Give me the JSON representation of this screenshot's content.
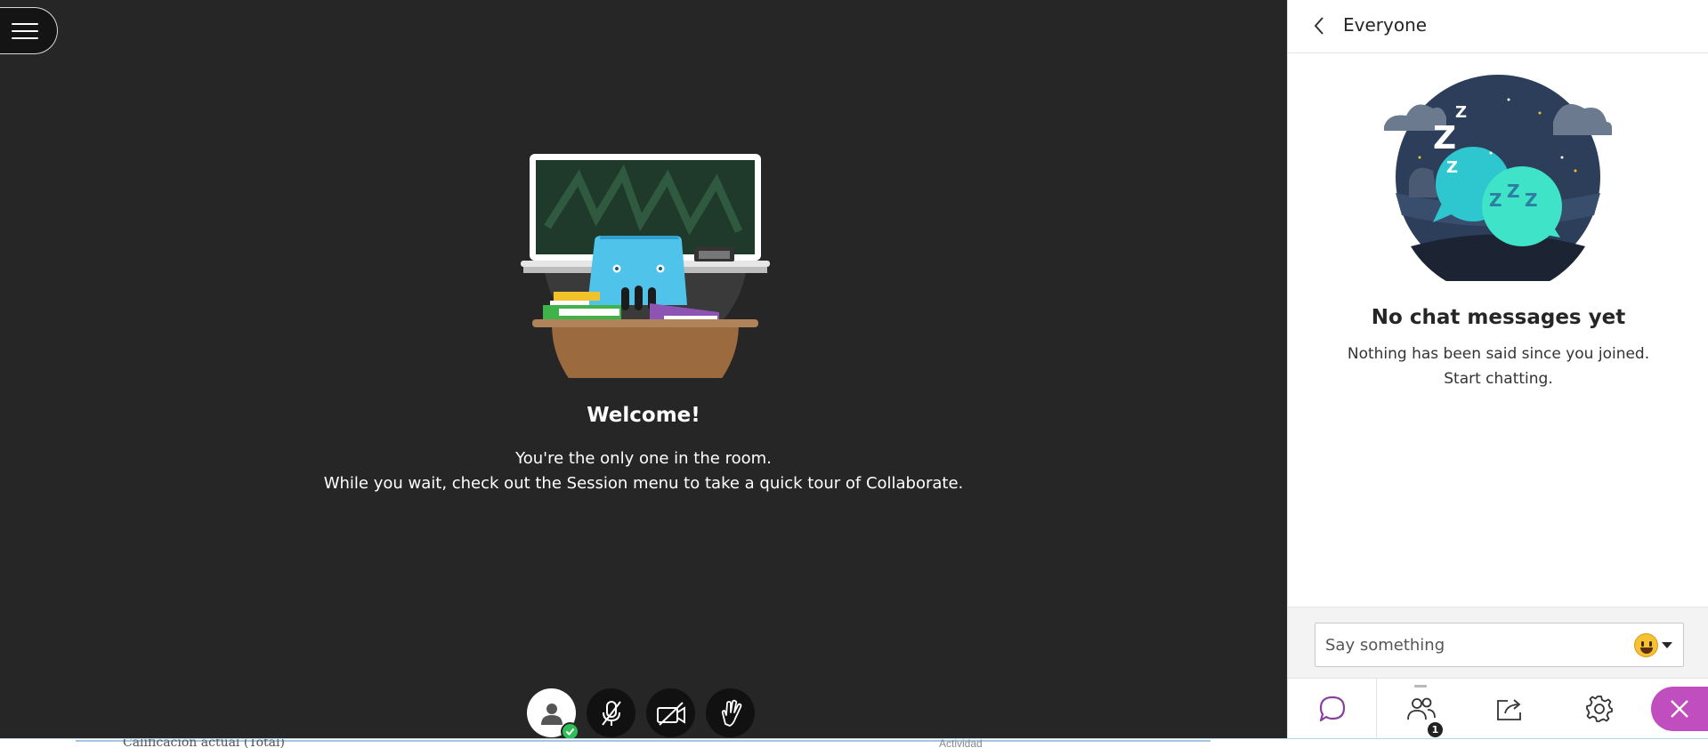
{
  "stage": {
    "menu_icon": "hamburger-icon",
    "welcome": {
      "title": "Welcome!",
      "line1": "You're the only one in the room.",
      "line2": "While you wait, check out the Session menu to take a quick tour of Collaborate."
    },
    "controls": [
      {
        "name": "avatar",
        "icon": "user-icon",
        "status": "check-icon"
      },
      {
        "name": "microphone",
        "icon": "mic-off-icon"
      },
      {
        "name": "camera",
        "icon": "camera-off-icon"
      },
      {
        "name": "raise-hand",
        "icon": "hand-icon"
      }
    ]
  },
  "panel": {
    "back_icon": "chevron-left-icon",
    "title": "Everyone",
    "empty": {
      "title": "No chat messages yet",
      "line1": "Nothing has been said since you joined.",
      "line2": "Start chatting."
    },
    "composer": {
      "placeholder": "Say something",
      "emoji_icon": "smiley-icon"
    },
    "tabs": [
      {
        "name": "chat",
        "icon": "chat-bubble-icon",
        "active": true
      },
      {
        "name": "attendees",
        "icon": "people-icon",
        "badge": "1"
      },
      {
        "name": "share",
        "icon": "share-icon"
      },
      {
        "name": "settings",
        "icon": "gear-icon"
      }
    ],
    "close_icon": "close-icon"
  },
  "colors": {
    "stage_bg": "#262626",
    "accent": "#c04ebe",
    "chat_active": "#8a3f9e",
    "ok_green": "#2fbf5a"
  },
  "background_page": {
    "text_a": "Calificación actual (Total)",
    "text_b": "Actividad"
  }
}
